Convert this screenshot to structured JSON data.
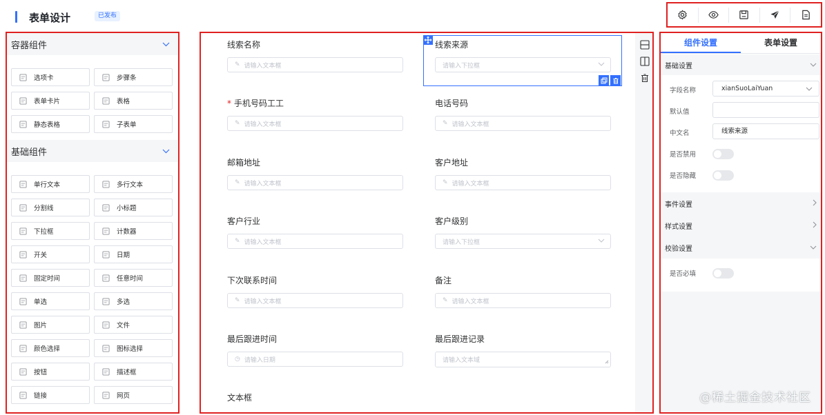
{
  "header": {
    "title": "表单设计",
    "badge": "已发布",
    "tools": [
      "gear-icon",
      "eye-icon",
      "save-icon",
      "send-icon",
      "document-icon"
    ]
  },
  "left": {
    "container_title": "容器组件",
    "container_items": [
      "选项卡",
      "步骤条",
      "表单卡片",
      "表格",
      "静态表格",
      "子表单"
    ],
    "basic_title": "基础组件",
    "basic_items": [
      "单行文本",
      "多行文本",
      "分割线",
      "小标题",
      "下拉框",
      "计数器",
      "开关",
      "日期",
      "固定时间",
      "任意时间",
      "单选",
      "多选",
      "图片",
      "文件",
      "颜色选择",
      "图标选择",
      "按钮",
      "描述框",
      "链接",
      "网页"
    ]
  },
  "form": {
    "fields": [
      {
        "label": "线索名称",
        "placeholder": "请输入文本框",
        "required": false,
        "kind": "text"
      },
      {
        "label": "线索来源",
        "placeholder": "请输入下拉框",
        "required": false,
        "kind": "select"
      },
      {
        "label": "手机号码工工",
        "placeholder": "请输入文本框",
        "required": true,
        "kind": "text"
      },
      {
        "label": "电话号码",
        "placeholder": "请输入文本框",
        "required": false,
        "kind": "text"
      },
      {
        "label": "邮箱地址",
        "placeholder": "请输入文本框",
        "required": false,
        "kind": "text"
      },
      {
        "label": "客户地址",
        "placeholder": "请输入文本框",
        "required": false,
        "kind": "text"
      },
      {
        "label": "客户行业",
        "placeholder": "请输入文本框",
        "required": false,
        "kind": "text"
      },
      {
        "label": "客户级别",
        "placeholder": "请输入下拉框",
        "required": false,
        "kind": "select"
      },
      {
        "label": "下次联系时间",
        "placeholder": "请输入文本框",
        "required": false,
        "kind": "text"
      },
      {
        "label": "备注",
        "placeholder": "请输入文本框",
        "required": false,
        "kind": "text"
      },
      {
        "label": "最后跟进时间",
        "placeholder": "请输入日期",
        "required": false,
        "kind": "date"
      },
      {
        "label": "最后跟进记录",
        "placeholder": "请输入文本域",
        "required": false,
        "kind": "textarea"
      },
      {
        "label": "文本框",
        "placeholder": "",
        "required": false,
        "kind": "none"
      }
    ]
  },
  "right": {
    "tabs": [
      "组件设置",
      "表单设置"
    ],
    "basic_section": "基础设置",
    "field_name_label": "字段名称",
    "field_name_value": "xianSuoLaiYuan",
    "default_label": "默认值",
    "default_value": "",
    "cn_name_label": "中文名",
    "cn_name_value": "线索来源",
    "disabled_label": "是否禁用",
    "hidden_label": "是否隐藏",
    "event_section": "事件设置",
    "style_section": "样式设置",
    "validate_section": "校验设置",
    "required_label": "是否必填"
  },
  "watermark": "@稀土掘金技术社区"
}
